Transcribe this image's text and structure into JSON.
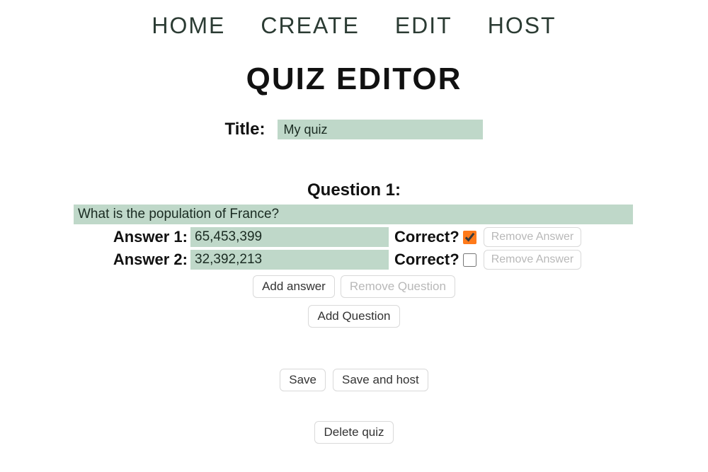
{
  "nav": {
    "home": "HOME",
    "create": "CREATE",
    "edit": "EDIT",
    "host": "HOST"
  },
  "page_title": "QUIZ EDITOR",
  "title_label": "Title:",
  "title_value": "My quiz",
  "question": {
    "heading": "Question 1:",
    "text": "What is the population of France?",
    "answers": [
      {
        "label": "Answer 1:",
        "value": "65,453,399",
        "correct": true
      },
      {
        "label": "Answer 2:",
        "value": "32,392,213",
        "correct": false
      }
    ]
  },
  "labels": {
    "correct": "Correct?",
    "remove_answer": "Remove Answer",
    "add_answer": "Add answer",
    "remove_question": "Remove Question",
    "add_question": "Add Question",
    "save": "Save",
    "save_and_host": "Save and host",
    "delete_quiz": "Delete quiz"
  }
}
